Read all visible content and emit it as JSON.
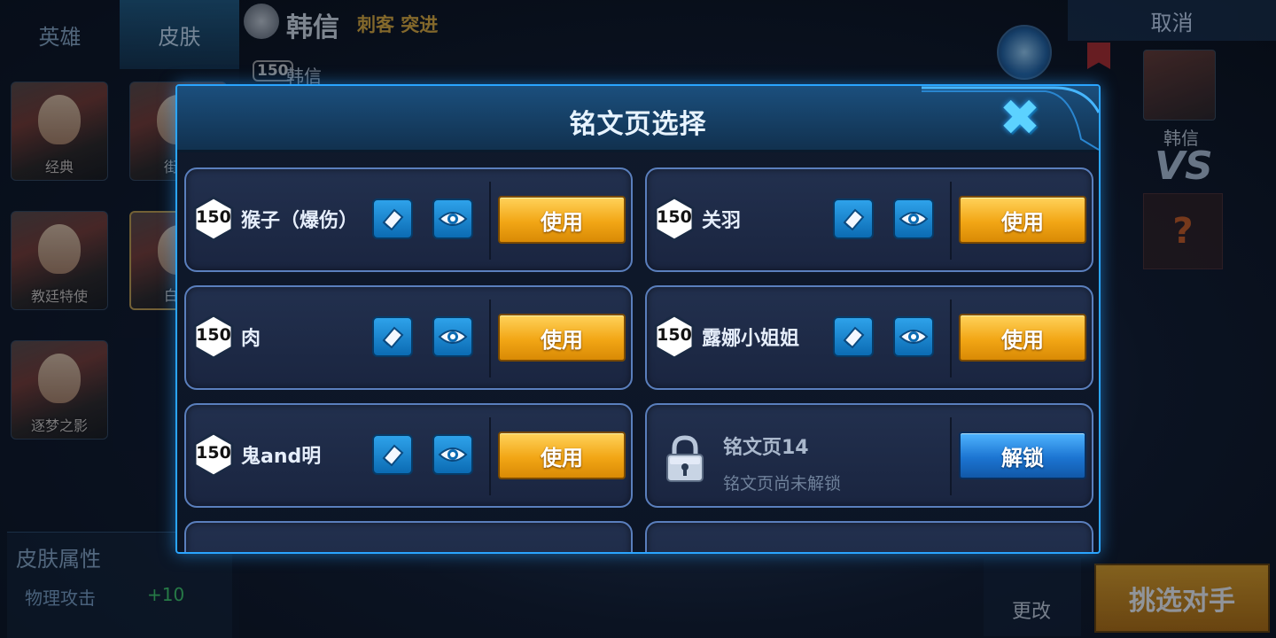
{
  "tabs": {
    "hero": "英雄",
    "skin": "皮肤"
  },
  "hero": {
    "name": "韩信",
    "roles": "刺客 突进",
    "level": "150",
    "level_name": "韩信"
  },
  "skins": [
    {
      "label": "经典"
    },
    {
      "label": "街头"
    },
    {
      "label": "教廷特使"
    },
    {
      "label": "白龙"
    },
    {
      "label": "逐梦之影"
    }
  ],
  "skin_attr": {
    "title": "皮肤属性",
    "stat_label": "物理攻击",
    "stat_value": "+10"
  },
  "right": {
    "cancel": "取消",
    "player_name": "韩信",
    "vs": "VS",
    "mystery": "?",
    "change": "更改",
    "pick_opponent": "挑选对手"
  },
  "modal": {
    "title": "铭文页选择",
    "use_label": "使用",
    "unlock_label": "解锁",
    "pages": [
      {
        "level": "150",
        "name": "猴子（爆伤）"
      },
      {
        "level": "150",
        "name": "关羽"
      },
      {
        "level": "150",
        "name": "肉"
      },
      {
        "level": "150",
        "name": "露娜小姐姐"
      },
      {
        "level": "150",
        "name": "鬼and明"
      }
    ],
    "locked_page": {
      "name": "铭文页14",
      "status": "铭文页尚未解锁"
    }
  },
  "colors": {
    "accent_blue": "#2aa5ff",
    "use_orange": "#f2a615",
    "unlock_blue": "#1c75d2",
    "stat_green": "#3fd06a"
  },
  "icons": {
    "edit": "eraser-edit-icon",
    "preview": "eye-icon",
    "close": "close-x-icon",
    "lock": "padlock-icon",
    "level": "hexagon-level-badge"
  }
}
